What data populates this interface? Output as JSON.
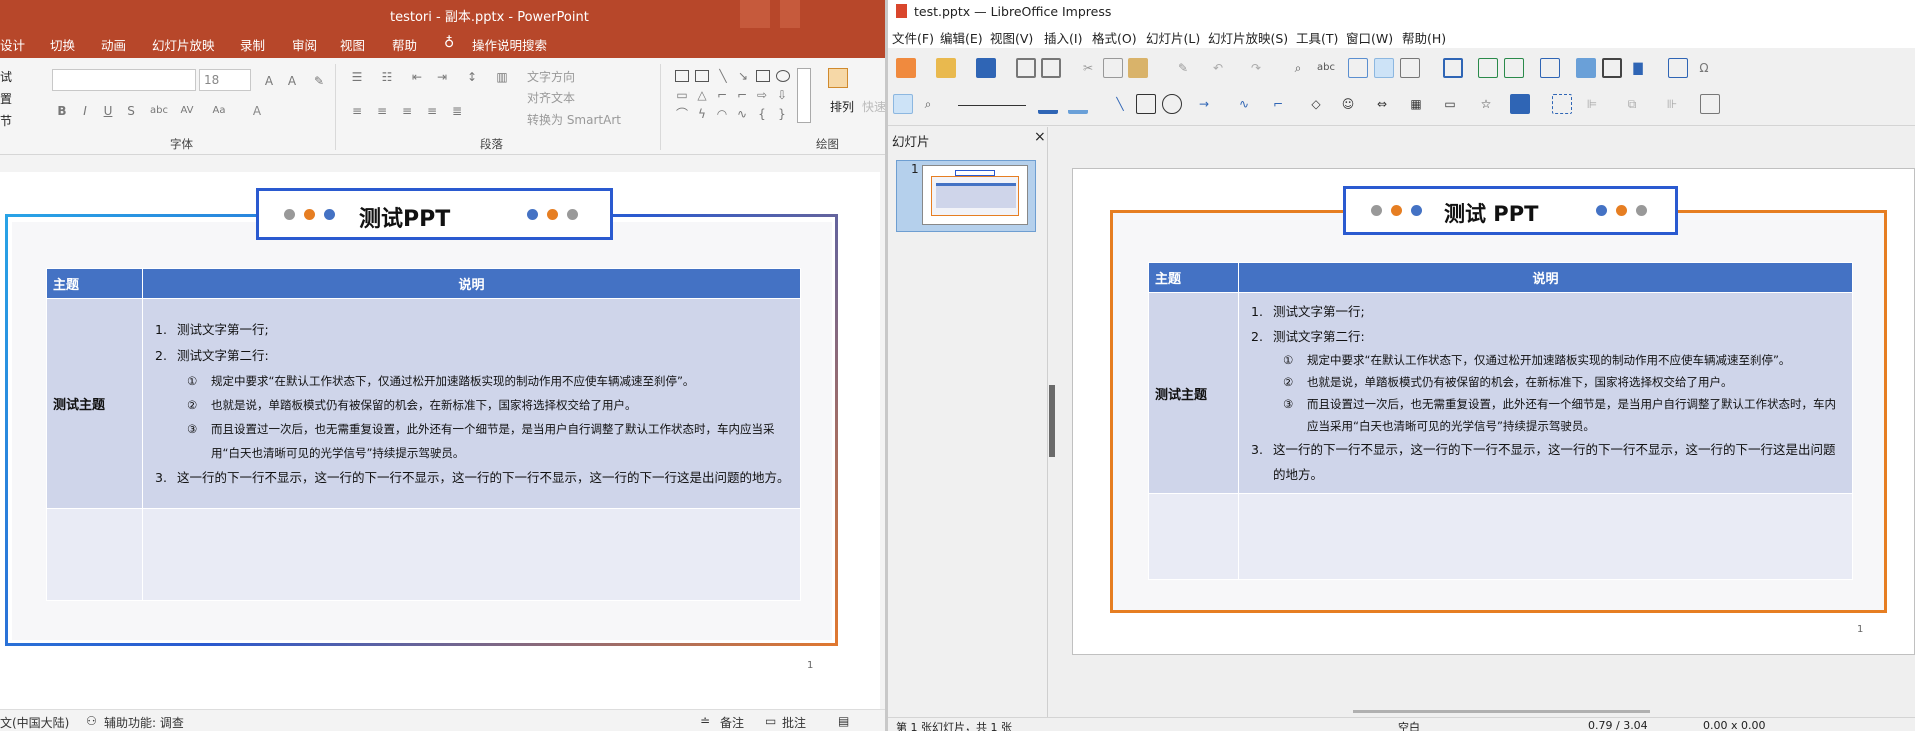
{
  "powerpoint": {
    "title": "testori - 副本.pptx  -  PowerPoint",
    "tabs": [
      "设计",
      "切换",
      "动画",
      "幻灯片放映",
      "录制",
      "审阅",
      "视图",
      "帮助",
      "操作说明搜索"
    ],
    "ribbon": {
      "font_size": "18",
      "text_direction": "文字方向",
      "align_text": "对齐文本",
      "smartart": "转换为 SmartArt",
      "arrange": "排列",
      "quick": "快速",
      "groups": [
        "字体",
        "段落",
        "绘图"
      ],
      "left_partial": [
        "试",
        "置",
        "节"
      ]
    },
    "slide": {
      "title": "测试PPT",
      "page_num": "1"
    },
    "status": {
      "language": "文(中国大陆)",
      "accessibility": "辅助功能: 调查",
      "notes": "备注",
      "comments": "批注"
    }
  },
  "libreoffice": {
    "title": "test.pptx — LibreOffice Impress",
    "menu": [
      "文件(F)",
      "编辑(E)",
      "视图(V)",
      "插入(I)",
      "格式(O)",
      "幻灯片(L)",
      "幻灯片放映(S)",
      "工具(T)",
      "窗口(W)",
      "帮助(H)"
    ],
    "panel_title": "幻灯片",
    "panel_close": "×",
    "thumb_num": "1",
    "slide": {
      "title": "测试 PPT",
      "page_num": "1"
    },
    "status": {
      "slide_info": "第 1 张幻灯片，共 1 张",
      "layout": "空白",
      "pos": "0.79 / 3.04",
      "size": "0.00 x 0.00"
    }
  },
  "table": {
    "headers": [
      "主题",
      "说明"
    ],
    "subject": "测试主题",
    "items": [
      {
        "n": "1.",
        "text": "测试文字第一行;"
      },
      {
        "n": "2.",
        "text": "测试文字第二行:"
      }
    ],
    "subitems": [
      {
        "n": "①",
        "text": "规定中要求“在默认工作状态下，仅通过松开加速踏板实现的制动作用不应使车辆减速至刹停”。"
      },
      {
        "n": "②",
        "text": "也就是说，单踏板模式仍有被保留的机会，在新标准下，国家将选择权交给了用户。"
      },
      {
        "n": "③",
        "text": "而且设置过一次后，也无需重复设置，此外还有一个细节是，是当用户自行调整了默认工作状态时，车内应当采用“白天也清晰可见的光学信号”持续提示驾驶员。"
      }
    ],
    "item3": {
      "n": "3.",
      "text": "这一行的下一行不显示，这一行的下一行不显示，这一行的下一行不显示，这一行的下一行这是出问题的地方。"
    }
  },
  "colors": {
    "pp_accent": "#b7472a",
    "header_blue": "#4472c4",
    "cell": "#cfd5ea",
    "lo_orange": "#e67e22"
  }
}
